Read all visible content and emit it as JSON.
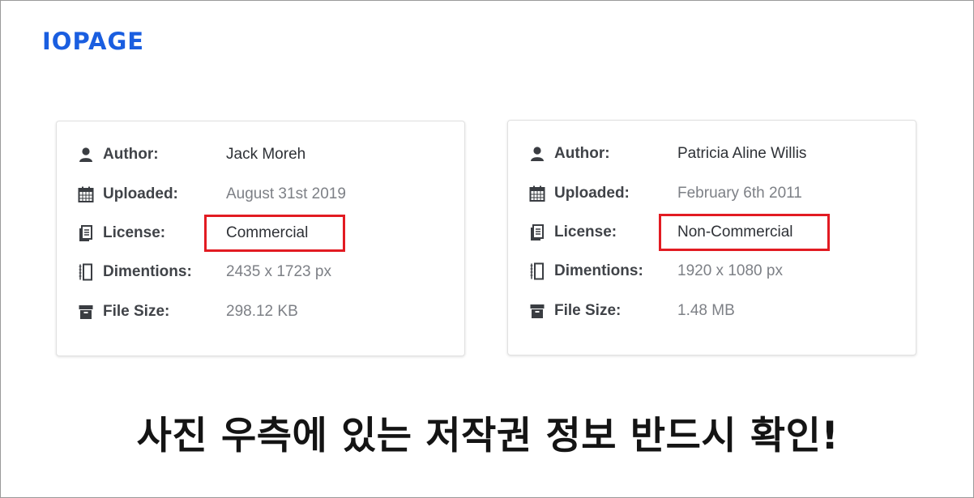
{
  "brand": {
    "logo_text": "IOPAGE",
    "accent_color": "#1a5ee0"
  },
  "cards": [
    {
      "author_label": "Author:",
      "author": "Jack Moreh",
      "uploaded_label": "Uploaded:",
      "uploaded": "August 31st 2019",
      "license_label": "License:",
      "license": "Commercial",
      "dimensions_label": "Dimentions:",
      "dimensions": "2435 x 1723 px",
      "filesize_label": "File Size:",
      "filesize": "298.12 KB"
    },
    {
      "author_label": "Author:",
      "author": "Patricia Aline Willis",
      "uploaded_label": "Uploaded:",
      "uploaded": "February 6th 2011",
      "license_label": "License:",
      "license": "Non-Commercial",
      "dimensions_label": "Dimentions:",
      "dimensions": "1920 x 1080 px",
      "filesize_label": "File Size:",
      "filesize": "1.48 MB"
    }
  ],
  "icons": [
    "user-icon",
    "calendar-icon",
    "license-icon",
    "dimensions-icon",
    "archive-icon"
  ],
  "highlight_color": "#e21b22",
  "headline": "사진 우측에 있는 저작권 정보 반드시 확인!"
}
